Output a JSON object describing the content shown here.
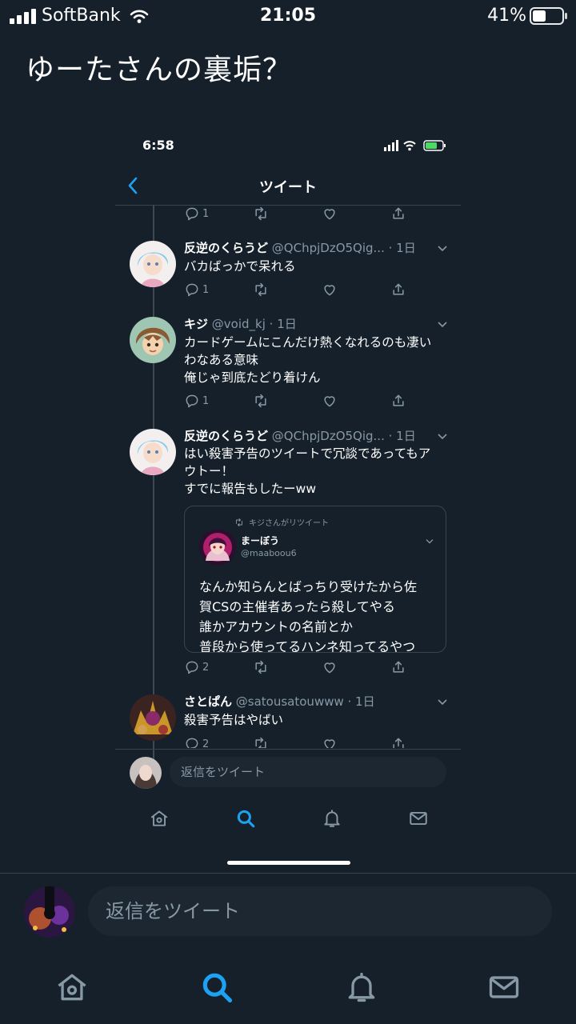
{
  "status_bar": {
    "carrier": "SoftBank",
    "time": "21:05",
    "battery": "41%"
  },
  "post": {
    "text": "ゆーたさんの裏垢？"
  },
  "screenshot": {
    "time": "6:58",
    "title": "ツイート",
    "top_actions": {
      "reply_count": "1"
    },
    "tweets": [
      {
        "name": "反逆のくらうど",
        "meta": "@QChpjDzO5Qig... · 1日",
        "lines": [
          "バカばっかで呆れる"
        ],
        "reply_count": "1"
      },
      {
        "name": "キジ",
        "meta": "@void_kj · 1日",
        "lines": [
          "カードゲームにこんだけ熱くなれるのも凄い",
          "わなある意味",
          "俺じゃ到底たどり着けん"
        ],
        "reply_count": "1"
      },
      {
        "name": "反逆のくらうど",
        "meta": "@QChpjDzO5Qig... · 1日",
        "lines": [
          "はい殺害予告のツイートで冗談であってもア",
          "ウトー！",
          "すでに報告もしたーww"
        ],
        "reply_count": "2"
      },
      {
        "name": "さとぱん",
        "meta": "@satousatouwww · 1日",
        "lines": [
          "殺害予告はやばい"
        ],
        "reply_count": "2"
      }
    ],
    "quote": {
      "retweet_label": "キジさんがリツイート",
      "name": "まーぼう",
      "handle": "@maaboou6",
      "lines": [
        "なんか知らんとばっちり受けたから佐",
        "賀CSの主催者あったら殺してやる",
        "誰かアカウントの名前とか",
        "普段から使ってるハンネ知ってるやつ"
      ]
    },
    "reply_placeholder": "返信をツイート",
    "tabs": [
      "home-icon",
      "search-icon",
      "bell-icon",
      "mail-icon"
    ],
    "active_tab": "search-icon"
  },
  "reply": {
    "placeholder": "返信をツイート"
  },
  "tabs": [
    "home-icon",
    "search-icon",
    "bell-icon",
    "mail-icon"
  ],
  "active_tab": "search-icon",
  "colors": {
    "background": "#15202b",
    "accent": "#1da1f2",
    "muted": "#8899a6",
    "border": "#38444d"
  }
}
